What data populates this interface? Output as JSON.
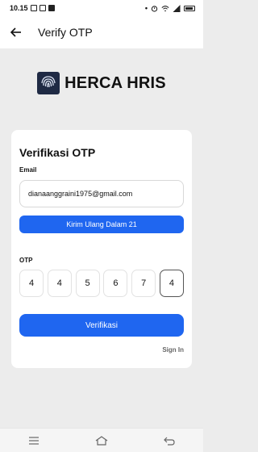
{
  "status_bar": {
    "time": "10.15",
    "icons": [
      "image-icon",
      "mail-icon",
      "b-icon"
    ],
    "right_icons": [
      "dot",
      "alarm-icon",
      "wifi-icon",
      "signal-icon",
      "battery-icon"
    ]
  },
  "app_bar": {
    "title": "Verify OTP"
  },
  "brand": {
    "name": "HERCA HRIS"
  },
  "card": {
    "title": "Verifikasi OTP",
    "email_label": "Email",
    "email_value": "dianaanggraini1975@gmail.com",
    "resend_label": "Kirim Ulang Dalam 21",
    "otp_label": "OTP",
    "otp_digits": [
      "4",
      "4",
      "5",
      "6",
      "7",
      "4"
    ],
    "verify_label": "Verifikasi",
    "signin_label": "Sign In"
  },
  "colors": {
    "primary": "#1f66f0",
    "logo_bg": "#1f2a44"
  }
}
